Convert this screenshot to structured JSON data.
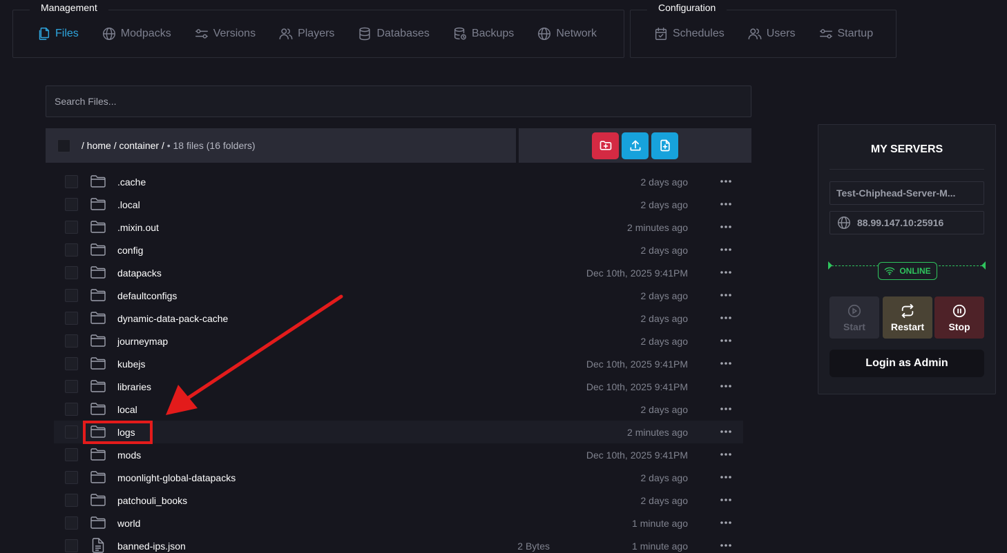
{
  "nav": {
    "management": {
      "legend": "Management",
      "items": [
        {
          "label": "Files",
          "icon": "files-icon",
          "active": true
        },
        {
          "label": "Modpacks",
          "icon": "globe-icon"
        },
        {
          "label": "Versions",
          "icon": "sliders-icon"
        },
        {
          "label": "Players",
          "icon": "users-icon"
        },
        {
          "label": "Databases",
          "icon": "database-icon"
        },
        {
          "label": "Backups",
          "icon": "database-restore-icon"
        },
        {
          "label": "Network",
          "icon": "globe-icon"
        }
      ]
    },
    "configuration": {
      "legend": "Configuration",
      "items": [
        {
          "label": "Schedules",
          "icon": "calendar-check-icon"
        },
        {
          "label": "Users",
          "icon": "users-icon"
        },
        {
          "label": "Startup",
          "icon": "sliders-icon"
        }
      ]
    }
  },
  "search": {
    "placeholder": "Search Files..."
  },
  "file_header": {
    "path": "/ home / container /",
    "meta": " • 18 files (16 folders)"
  },
  "files": [
    {
      "name": ".cache",
      "type": "folder",
      "size": "",
      "modified": "2 days ago"
    },
    {
      "name": ".local",
      "type": "folder",
      "size": "",
      "modified": "2 days ago"
    },
    {
      "name": ".mixin.out",
      "type": "folder",
      "size": "",
      "modified": "2 minutes ago"
    },
    {
      "name": "config",
      "type": "folder",
      "size": "",
      "modified": "2 days ago"
    },
    {
      "name": "datapacks",
      "type": "folder",
      "size": "",
      "modified": "Dec 10th, 2025 9:41PM"
    },
    {
      "name": "defaultconfigs",
      "type": "folder",
      "size": "",
      "modified": "2 days ago"
    },
    {
      "name": "dynamic-data-pack-cache",
      "type": "folder",
      "size": "",
      "modified": "2 days ago"
    },
    {
      "name": "journeymap",
      "type": "folder",
      "size": "",
      "modified": "2 days ago"
    },
    {
      "name": "kubejs",
      "type": "folder",
      "size": "",
      "modified": "Dec 10th, 2025 9:41PM"
    },
    {
      "name": "libraries",
      "type": "folder",
      "size": "",
      "modified": "Dec 10th, 2025 9:41PM"
    },
    {
      "name": "local",
      "type": "folder",
      "size": "",
      "modified": "2 days ago"
    },
    {
      "name": "logs",
      "type": "folder",
      "size": "",
      "modified": "2 minutes ago",
      "highlighted": true
    },
    {
      "name": "mods",
      "type": "folder",
      "size": "",
      "modified": "Dec 10th, 2025 9:41PM"
    },
    {
      "name": "moonlight-global-datapacks",
      "type": "folder",
      "size": "",
      "modified": "2 days ago"
    },
    {
      "name": "patchouli_books",
      "type": "folder",
      "size": "",
      "modified": "2 days ago"
    },
    {
      "name": "world",
      "type": "folder",
      "size": "",
      "modified": "1 minute ago"
    },
    {
      "name": "banned-ips.json",
      "type": "file",
      "size": "2 Bytes",
      "modified": "1 minute ago"
    }
  ],
  "servers": {
    "title": "MY SERVERS",
    "name": "Test-Chiphead-Server-M...",
    "address": "88.99.147.10:25916",
    "status": "ONLINE",
    "start_label": "Start",
    "restart_label": "Restart",
    "stop_label": "Stop",
    "login_label": "Login as Admin"
  },
  "colors": {
    "accent": "#2ea5dd",
    "danger": "#d42a43",
    "online": "#2fc45d",
    "annotation": "#e31b1b"
  }
}
